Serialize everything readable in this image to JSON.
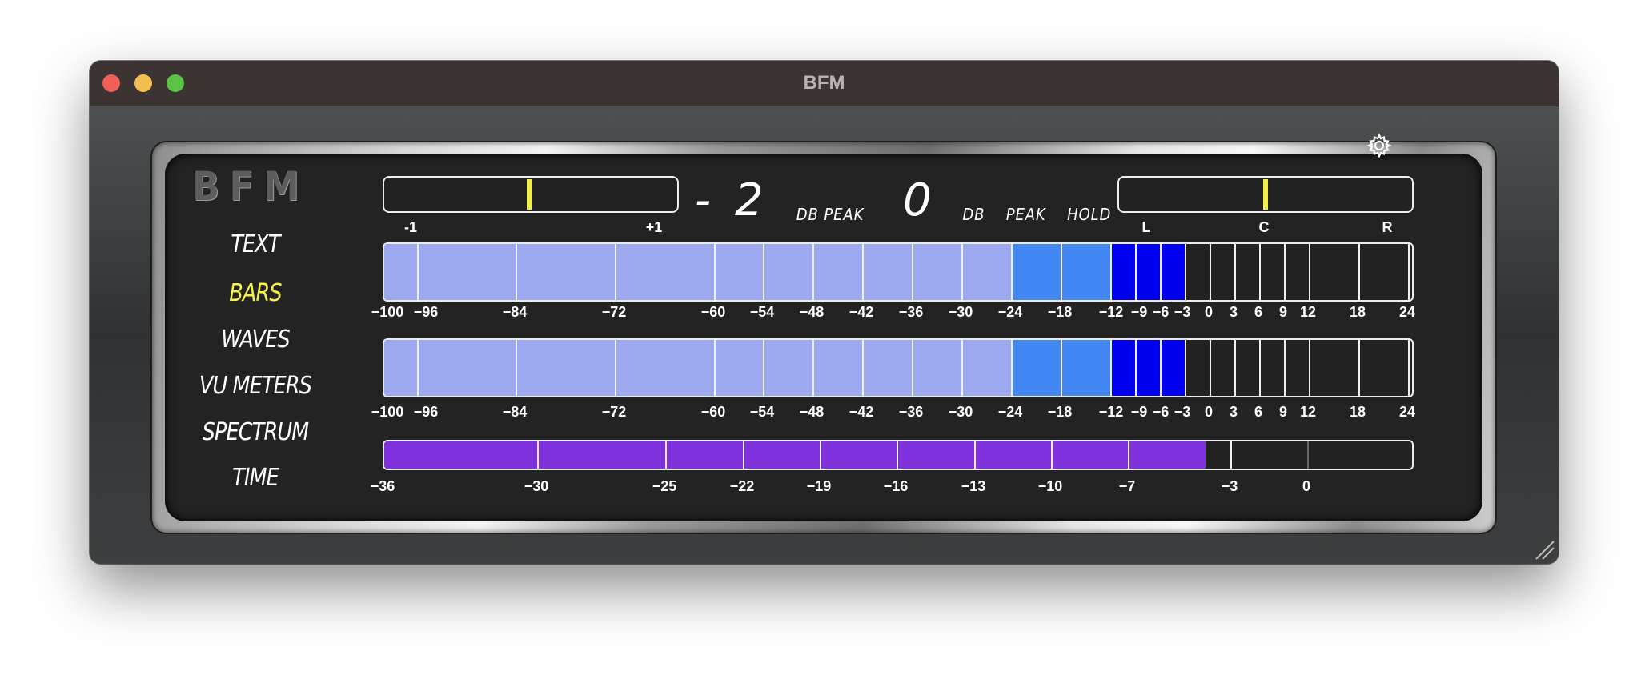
{
  "window": {
    "title": "BFM"
  },
  "logo": "BFM",
  "menu": [
    {
      "label": "TEXT",
      "active": false
    },
    {
      "label": "BARS",
      "active": true
    },
    {
      "label": "WAVES",
      "active": false
    },
    {
      "label": "VU METERS",
      "active": false
    },
    {
      "label": "SPECTRUM",
      "active": false
    },
    {
      "label": "TIME",
      "active": false
    }
  ],
  "readouts": {
    "peak_value": "- 2",
    "peak_label": "DB PEAK",
    "peak_hold_value": "0",
    "peak_hold_label": "DB PEAK HOLD"
  },
  "correlation_meter": {
    "min_label": "-1",
    "max_label": "+1",
    "value": -0.01
  },
  "balance_meter": {
    "labels": [
      "L",
      "C",
      "R"
    ],
    "value": 0.0
  },
  "level_meters": [
    {
      "channel": "1",
      "level_db": -3
    },
    {
      "channel": "2",
      "level_db": -3
    }
  ],
  "db_scale": [
    "-100",
    "-96",
    "-84",
    "-72",
    "-60",
    "-54",
    "-48",
    "-42",
    "-36",
    "-30",
    "-24",
    "-18",
    "-12",
    "-9",
    "-6",
    "-3",
    "0",
    "3",
    "6",
    "9",
    "12",
    "18",
    "24"
  ],
  "loudness_meter": {
    "level": -5
  },
  "loudness_scale": [
    "-36",
    "-30",
    "-25",
    "-22",
    "-19",
    "-16",
    "-13",
    "-10",
    "-7",
    "-3",
    "0"
  ],
  "colors": {
    "light_blue": "#9da9ef",
    "mid_blue": "#4387f5",
    "deep_blue": "#0000ee",
    "purple": "#7e31dc",
    "needle": "#f4ee49",
    "active_menu": "#f6f24a"
  },
  "settings_icon": "gear-icon"
}
